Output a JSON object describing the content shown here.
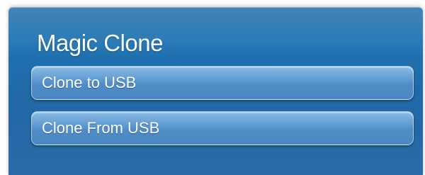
{
  "menu": {
    "title": "Magic Clone",
    "items": [
      {
        "label": "Clone to USB"
      },
      {
        "label": "Clone From USB"
      }
    ]
  },
  "colors": {
    "panel": "#2068a6",
    "item": "#5a95cd",
    "text": "#ffffff"
  }
}
